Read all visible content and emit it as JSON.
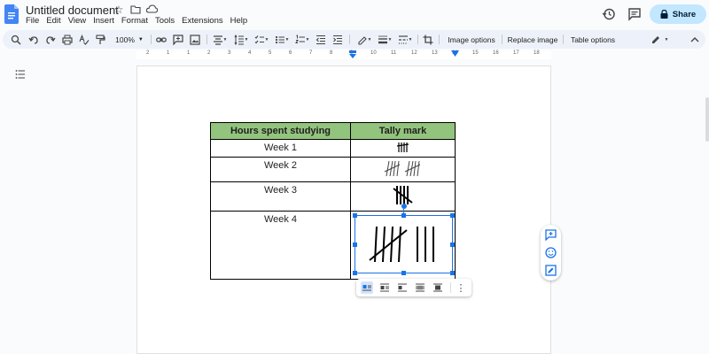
{
  "header": {
    "title": "Untitled document",
    "menus": [
      "File",
      "Edit",
      "View",
      "Insert",
      "Format",
      "Tools",
      "Extensions",
      "Help"
    ],
    "share_label": "Share"
  },
  "toolbar": {
    "zoom": "100%",
    "image_options": "Image options",
    "replace_image": "Replace image",
    "table_options": "Table options"
  },
  "ruler": {
    "numbers": [
      "2",
      "1",
      "1",
      "2",
      "3",
      "4",
      "5",
      "6",
      "7",
      "8",
      "9",
      "10",
      "11",
      "12",
      "13",
      "14",
      "15",
      "16",
      "17",
      "18"
    ]
  },
  "table": {
    "headers": [
      "Hours spent studying",
      "Tally mark"
    ],
    "rows": [
      {
        "label": "Week 1",
        "tally": 5
      },
      {
        "label": "Week 2",
        "tally": 8
      },
      {
        "label": "Week 3",
        "tally": 5
      },
      {
        "label": "Week 4",
        "tally": 8
      }
    ]
  },
  "colors": {
    "accent": "#1a73e8",
    "header_fill": "#93c47d",
    "share_bg": "#c2e7ff",
    "toolbar_bg": "#edf2fa"
  }
}
